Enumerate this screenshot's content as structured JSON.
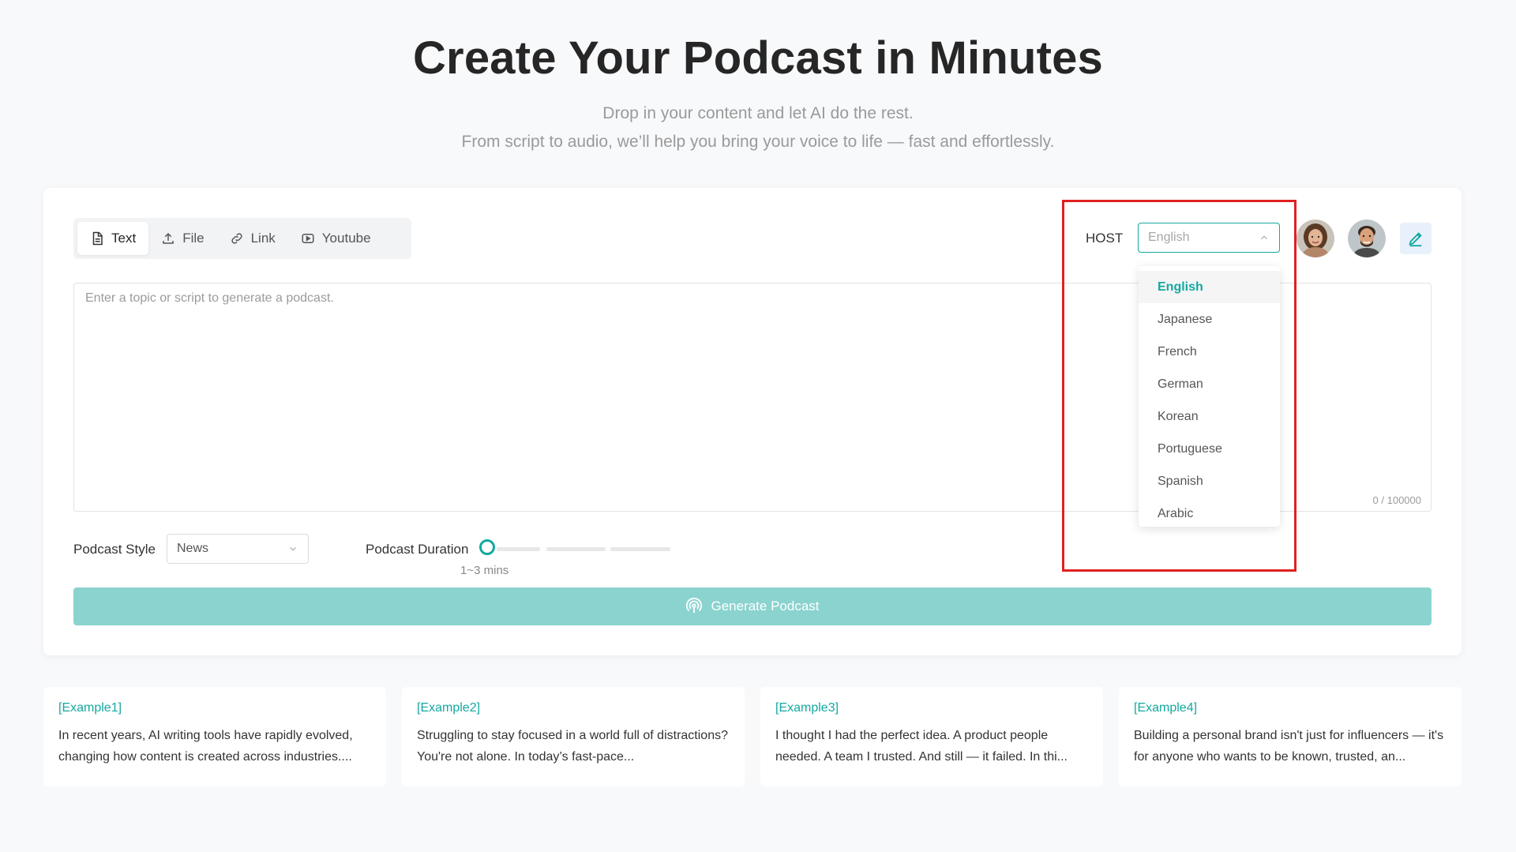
{
  "hero": {
    "title": "Create Your Podcast in Minutes",
    "subtitle_line1": "Drop in your content and let AI do the rest.",
    "subtitle_line2": "From script to audio, we’ll help you bring your voice to life — fast and effortlessly."
  },
  "tabs": [
    {
      "label": "Text",
      "icon": "document-icon",
      "active": true
    },
    {
      "label": "File",
      "icon": "upload-icon",
      "active": false
    },
    {
      "label": "Link",
      "icon": "link-icon",
      "active": false
    },
    {
      "label": "Youtube",
      "icon": "youtube-icon",
      "active": false
    }
  ],
  "editor": {
    "placeholder": "Enter a topic or script to generate a podcast.",
    "counter": "0 / 100000"
  },
  "host": {
    "label": "HOST",
    "selected_language": "English",
    "languages": [
      "English",
      "Japanese",
      "French",
      "German",
      "Korean",
      "Portuguese",
      "Spanish",
      "Arabic"
    ]
  },
  "settings": {
    "style_label": "Podcast Style",
    "style_value": "News",
    "duration_label": "Podcast Duration",
    "duration_value": "1~3 mins"
  },
  "generate": {
    "label": "Generate Podcast"
  },
  "examples": [
    {
      "tag": "[Example1]",
      "text": "In recent years, AI writing tools have rapidly evolved, changing how content is created across industries...."
    },
    {
      "tag": "[Example2]",
      "text": "Struggling to stay focused in a world full of distractions? You're not alone. In today’s fast-pace..."
    },
    {
      "tag": "[Example3]",
      "text": "I thought I had the perfect idea. A product people needed. A team I trusted. And still — it failed. In thi..."
    },
    {
      "tag": "[Example4]",
      "text": "Building a personal brand isn't just for influencers — it's for anyone who wants to be known, trusted, an..."
    }
  ],
  "colors": {
    "accent": "#14a8a0",
    "generate_button": "#8ad3cf",
    "highlight": "#e02020",
    "background": "#f8f9fb"
  }
}
